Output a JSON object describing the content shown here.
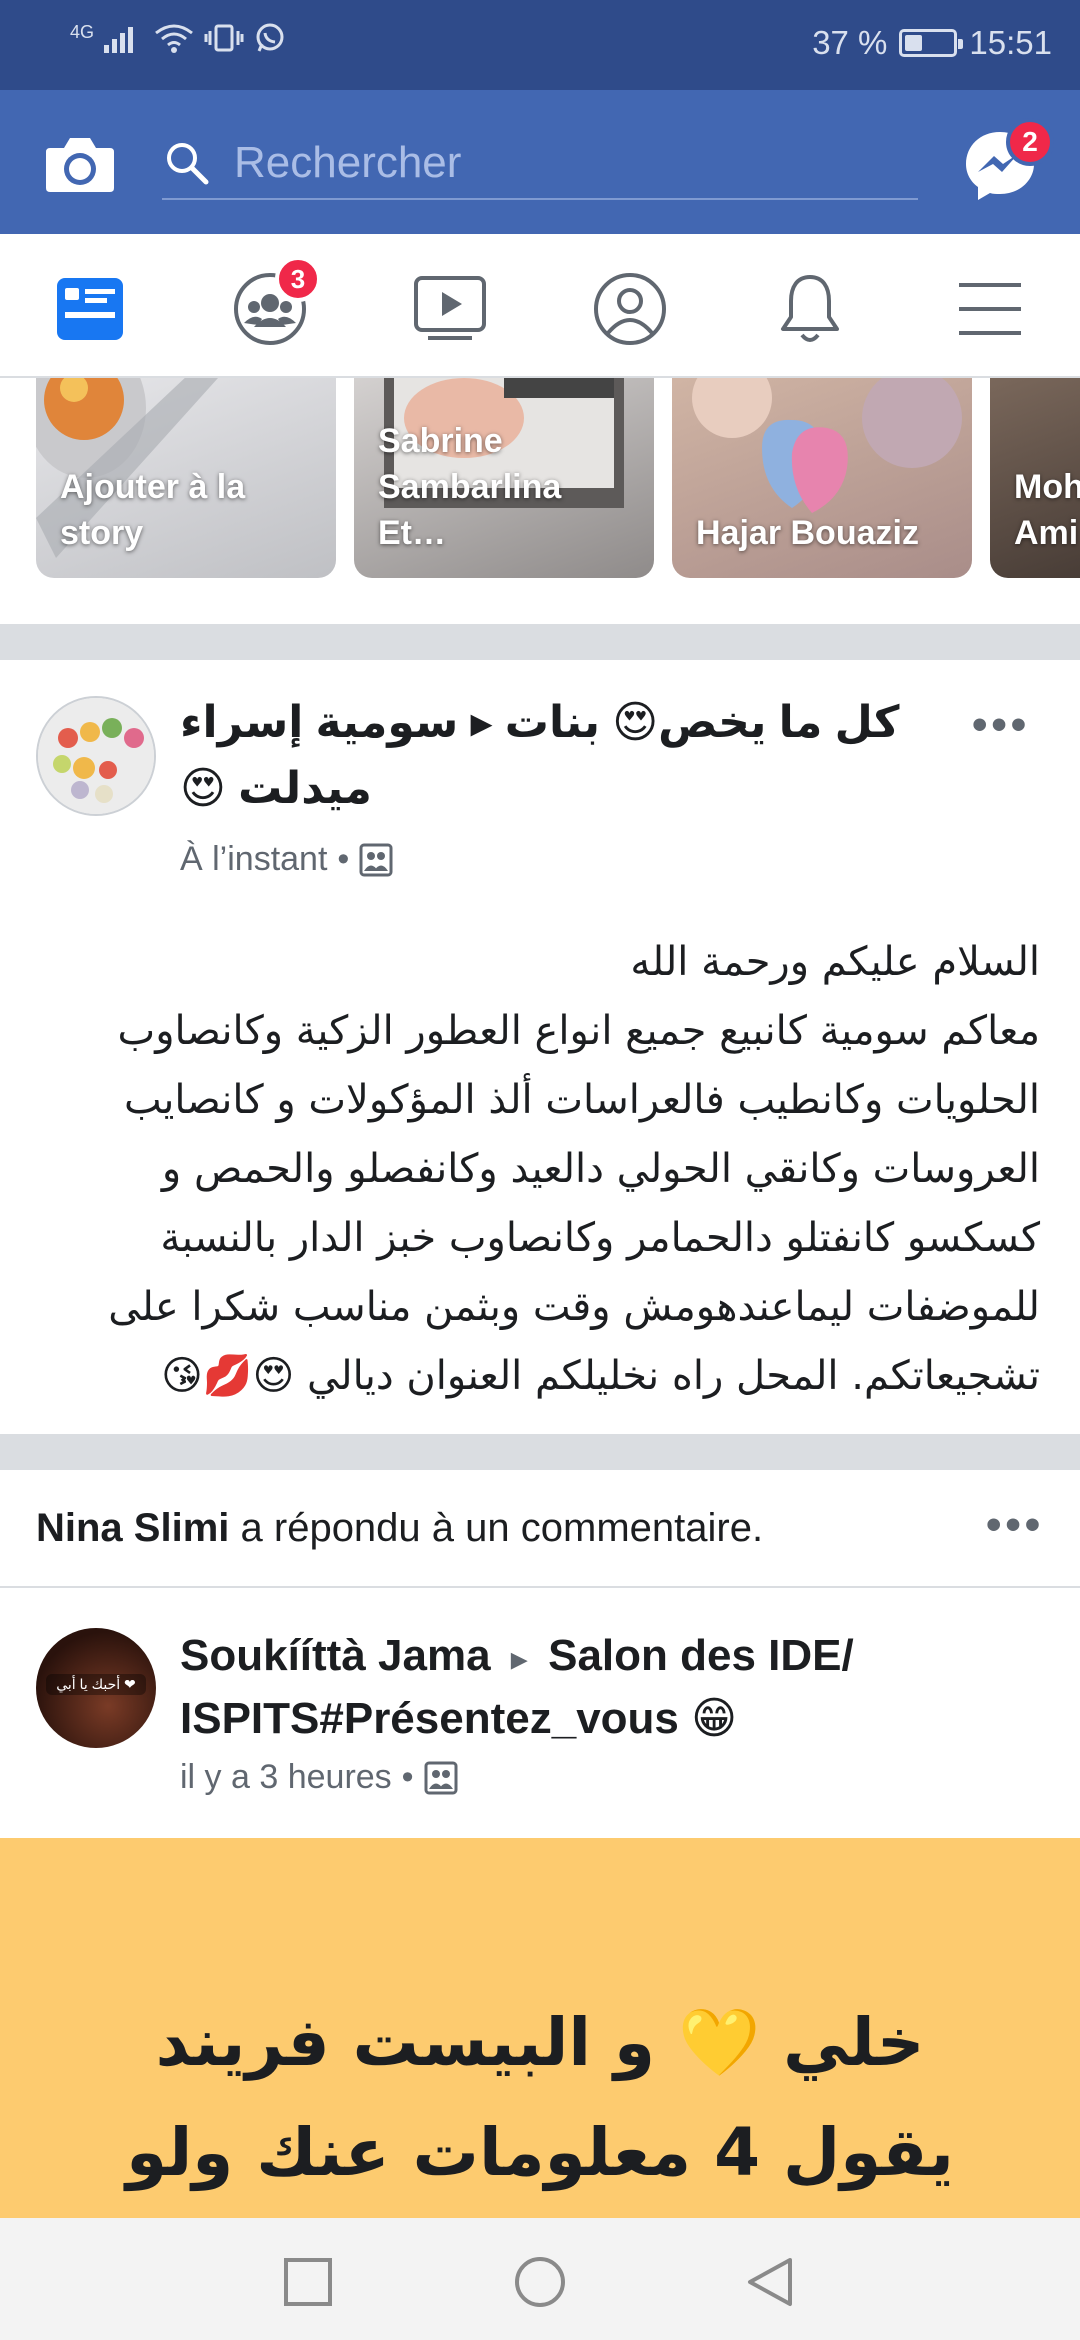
{
  "status_bar": {
    "network": "4G",
    "battery_percent": "37 %",
    "battery_level": 0.37,
    "time": "15:51"
  },
  "header": {
    "search_placeholder": "Rechercher",
    "messenger_badge": "2",
    "brand_color": "#4267b2"
  },
  "tabs": [
    {
      "name": "news-feed",
      "active": true
    },
    {
      "name": "groups",
      "badge": "3"
    },
    {
      "name": "watch"
    },
    {
      "name": "profile"
    },
    {
      "name": "notifications"
    },
    {
      "name": "menu"
    }
  ],
  "stories": [
    {
      "label": "Ajouter à la story"
    },
    {
      "label": "Sabrine Sambarlina Et…"
    },
    {
      "label": "Hajar Bouaziz"
    },
    {
      "label": "Moh Ami"
    }
  ],
  "post1": {
    "title": "كل ما يخص😍 بنات ▸ سومية إسراء ميدلت 😍",
    "time": "À l’instant",
    "body": "السلام عليكم ورحمة الله\nمعاكم سومية كانبيع جميع انواع العطور الزكية وكانصاوب\nالحلويات وكانطيب فالعراسات ألذ المؤكولات و كانصايب\nالعروسات وكانقي  الحولي دالعيد وكانفصلو  والحمص و\nكسكسو كانفتلو دالحمامر وكانصاوب خبز الدار بالنسبة\nللموضفات ليماعندهومش وقت وبثمن مناسب شكرا على\nتشجيعاتكم.  المحل راه نخليلكم العنوان ديالي 😍💋😘"
  },
  "activity": {
    "name": "Nina Slimi",
    "text": "a répondu à un commentaire."
  },
  "post2": {
    "author": "Soukííttà Jama",
    "arrow": "▸",
    "group": "Salon des IDE/ ISPITS#Présentez_vous 😁",
    "time": "il y a 3 heures",
    "avatar_text": "أحبك يا أبي ❤"
  },
  "color_post": {
    "text": "خلي 💛 و البيست فريند\nيقول 4 معلومات عنك  ولو",
    "background": "#fdcb6f"
  },
  "nav": [
    "recent-apps",
    "home",
    "back"
  ]
}
